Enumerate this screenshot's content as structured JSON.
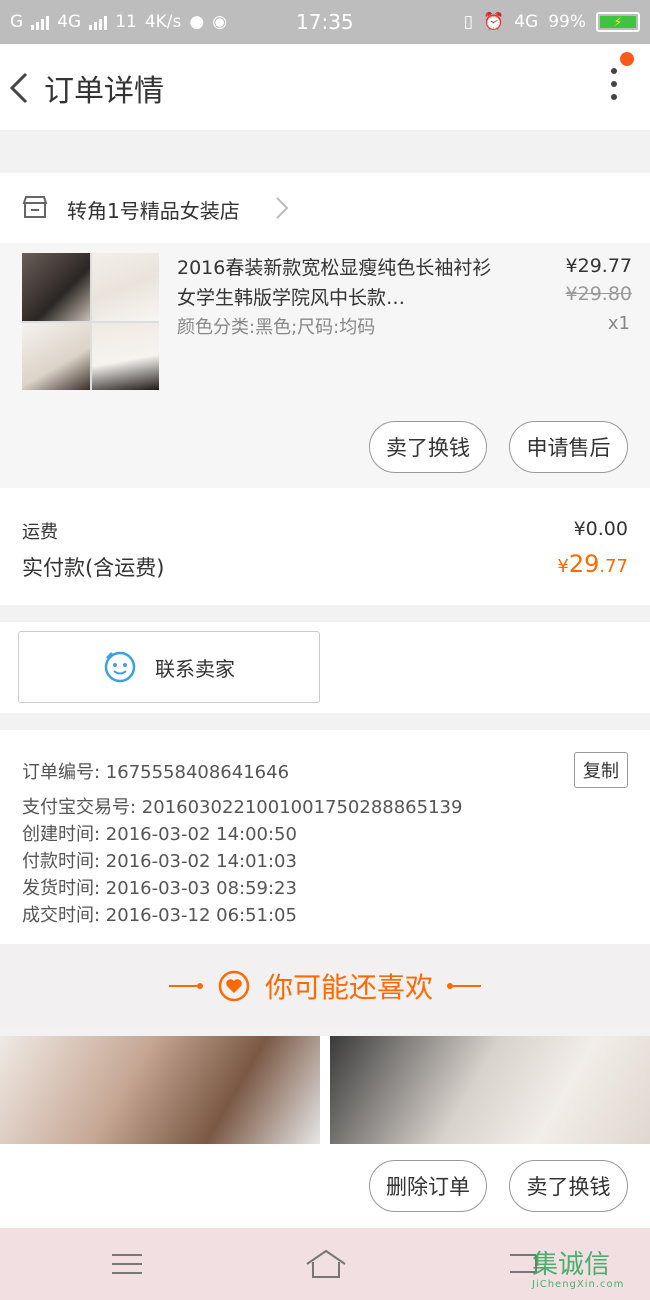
{
  "status_bar": {
    "left_text": "G",
    "net1": "4G",
    "net2": "11",
    "speed": "4K/s",
    "time": "17:35",
    "net_right": "4G",
    "battery": "99%"
  },
  "nav": {
    "title": "订单详情"
  },
  "shop": {
    "name": "转角1号精品女装店"
  },
  "item": {
    "title": "2016春装新款宽松显瘦纯色长袖衬衫女学生韩版学院风中长款…",
    "sku": "颜色分类:黑色;尺码:均码",
    "price_now": "¥29.77",
    "price_old": "¥29.80",
    "qty": "x1",
    "sell_button": "卖了换钱",
    "after_sale_button": "申请售后"
  },
  "fees": {
    "shipping_label": "运费",
    "shipping_value": "¥0.00",
    "paid_label": "实付款(含运费)",
    "paid_currency": "¥",
    "paid_integer": "29",
    "paid_decimal": ".77"
  },
  "contact": {
    "label": "联系卖家"
  },
  "order_info": {
    "order_no": "订单编号: 1675558408641646",
    "alipay_no": "支付宝交易号: 2016030221001001750288865139",
    "created": "创建时间: 2016-03-02  14:00:50",
    "paid": "付款时间: 2016-03-02  14:01:03",
    "shipped": "发货时间: 2016-03-03  08:59:23",
    "completed": "成交时间: 2016-03-12  06:51:05",
    "copy_button": "复制"
  },
  "guess": {
    "title": "你可能还喜欢"
  },
  "bottom": {
    "delete_button": "删除订单",
    "sell_button": "卖了换钱"
  },
  "watermark": {
    "text": "集诚信",
    "sub": "JiChengXin.com"
  },
  "colors": {
    "accent": "#ff6a00",
    "link_blue": "#3aa0e8"
  }
}
